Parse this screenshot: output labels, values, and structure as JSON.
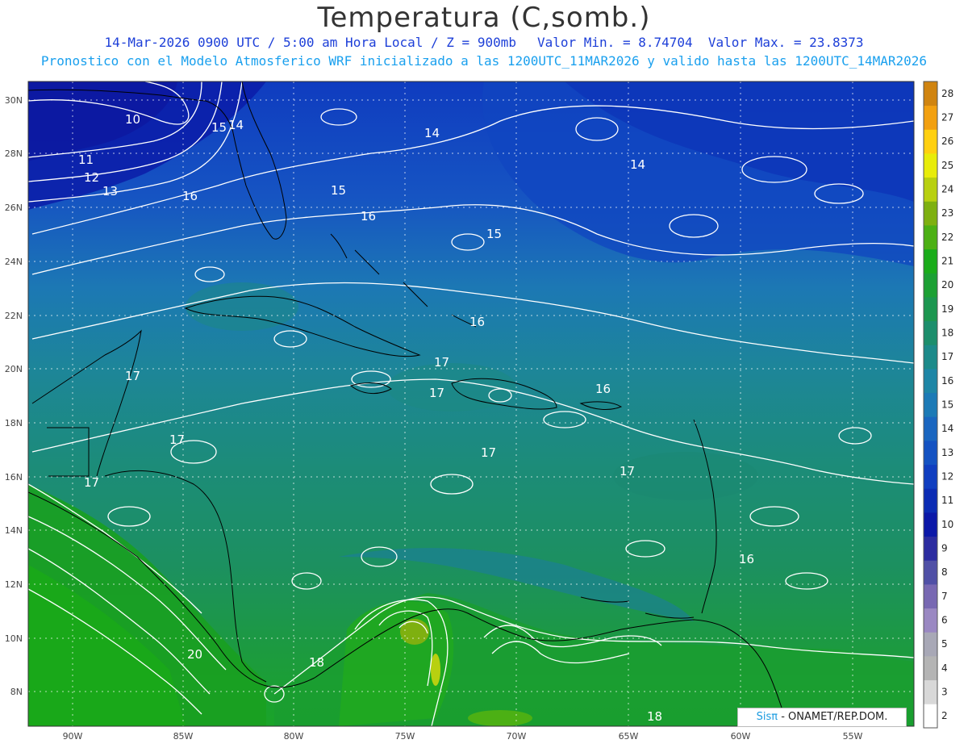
{
  "header": {
    "title": "Temperatura (C,somb.)",
    "date_time": "14-Mar-2026  0900 UTC / 5:00 am Hora Local / Z = 900mb",
    "valor_min": "Valor Min. = 8.74704",
    "valor_max": "Valor Max. = 23.8373",
    "forecast_info": "Pronostico con el Modelo Atmosferico WRF inicializado a las 1200UTC_11MAR2026 y valido hasta las  1200UTC_14MAR2026"
  },
  "map": {
    "lon_labels": [
      "90W",
      "85W",
      "80W",
      "75W",
      "70W",
      "65W",
      "60W",
      "55W"
    ],
    "lat_labels": [
      "30N",
      "28N",
      "26N",
      "24N",
      "22N",
      "20N",
      "18N",
      "16N",
      "14N",
      "12N",
      "10N",
      "8N"
    ],
    "contour_labels": [
      "10",
      "11",
      "12",
      "13",
      "15",
      "14",
      "16",
      "15",
      "16",
      "15",
      "14",
      "14",
      "16",
      "17",
      "17",
      "16",
      "17",
      "17",
      "17",
      "17",
      "17",
      "16",
      "20",
      "18",
      "18"
    ]
  },
  "colorbar": {
    "levels": [
      "2",
      "3",
      "4",
      "5",
      "6",
      "7",
      "8",
      "9",
      "10",
      "11",
      "12",
      "13",
      "14",
      "15",
      "16",
      "17",
      "18",
      "19",
      "20",
      "21",
      "22",
      "23",
      "24",
      "25",
      "26",
      "27",
      "28"
    ],
    "colors": [
      "#ffffff",
      "#d8d8d8",
      "#b4b4b4",
      "#a8a8b6",
      "#9a88c2",
      "#7868b2",
      "#5050a6",
      "#2c2ca0",
      "#0c18a8",
      "#0c2cb4",
      "#103ec0",
      "#1452c2",
      "#1a66c0",
      "#1c7ab6",
      "#1e86a6",
      "#1c8a8a",
      "#1c8e6c",
      "#1c9650",
      "#1ca034",
      "#1aac1a",
      "#4cb014",
      "#7eb010",
      "#b8d010",
      "#e8ec0a",
      "#ffd010",
      "#f2a010",
      "#d08410"
    ],
    "colors_note": ""
  },
  "footer": {
    "brand": "SisPi",
    "brand_symbol": "Sisπ",
    "org": " - ONAMET/REP.DOM."
  }
}
